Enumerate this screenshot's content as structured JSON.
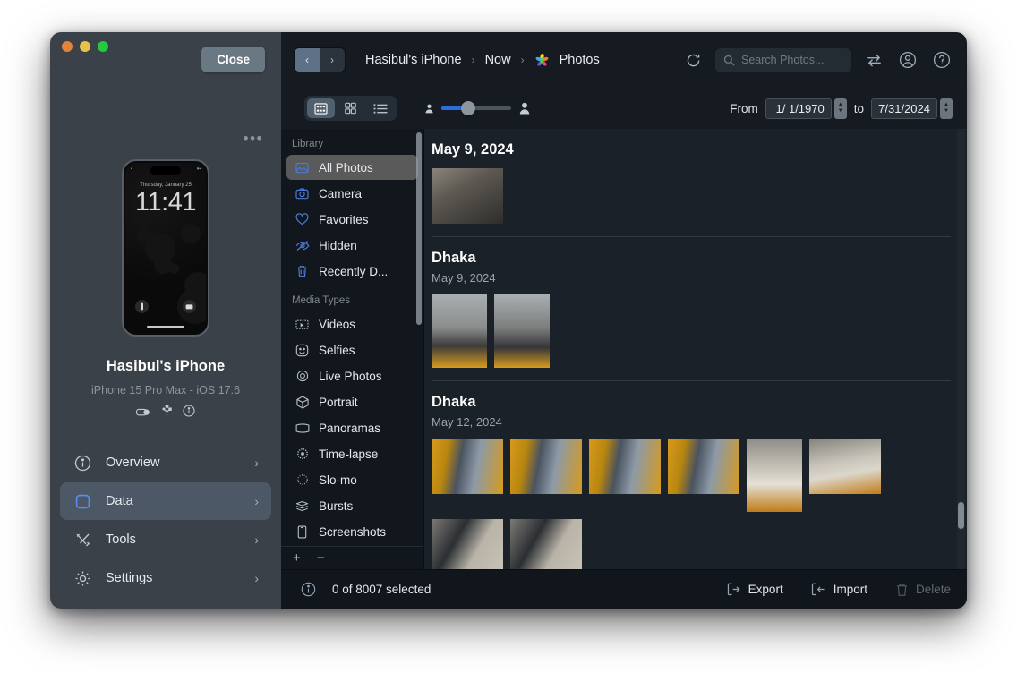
{
  "window": {
    "close_label": "Close",
    "overflow_label": "•••"
  },
  "device": {
    "name": "Hasibul's iPhone",
    "model": "iPhone 15 Pro Max - iOS 17.6",
    "lock_time": "11:41",
    "lock_date": "Thursday, January 25",
    "status_icons": [
      "battery-icon",
      "usb-icon",
      "info-icon"
    ],
    "nav": [
      {
        "label": "Overview",
        "icon": "info-circle-icon",
        "active": false
      },
      {
        "label": "Data",
        "icon": "square-icon",
        "active": true
      },
      {
        "label": "Tools",
        "icon": "tools-icon",
        "active": false
      },
      {
        "label": "Settings",
        "icon": "gear-icon",
        "active": false
      }
    ]
  },
  "topbar": {
    "back_label": "‹",
    "forward_label": "›",
    "breadcrumbs": [
      "Hasibul's iPhone",
      "Now",
      "Photos"
    ],
    "separator": "›",
    "app_icon": "photos-flower-icon",
    "search_placeholder": "Search Photos...",
    "search_value": "",
    "icons": [
      "refresh-icon",
      "search-icon",
      "transfer-icon",
      "account-icon",
      "help-icon"
    ]
  },
  "toolbar": {
    "views": [
      {
        "name": "grid-compact-view",
        "active": true
      },
      {
        "name": "grid-large-view",
        "active": false
      },
      {
        "name": "list-view",
        "active": false
      }
    ],
    "zoom_percent": 38,
    "from_label": "From",
    "to_label": "to",
    "from_date": "1/  1/1970",
    "to_date": "7/31/2024"
  },
  "library": {
    "sections": [
      {
        "header": "Library",
        "items": [
          {
            "label": "All Photos",
            "icon": "photos-icon",
            "active": true,
            "tint": "blue"
          },
          {
            "label": "Camera",
            "icon": "camera-icon",
            "active": false,
            "tint": "blue"
          },
          {
            "label": "Favorites",
            "icon": "heart-icon",
            "active": false,
            "tint": "blue"
          },
          {
            "label": "Hidden",
            "icon": "eye-slash-icon",
            "active": false,
            "tint": "blue"
          },
          {
            "label": "Recently D...",
            "icon": "trash-icon",
            "active": false,
            "tint": "blue"
          }
        ]
      },
      {
        "header": "Media Types",
        "items": [
          {
            "label": "Videos",
            "icon": "video-icon",
            "active": false,
            "tint": "gray"
          },
          {
            "label": "Selfies",
            "icon": "selfie-icon",
            "active": false,
            "tint": "gray"
          },
          {
            "label": "Live Photos",
            "icon": "live-photo-icon",
            "active": false,
            "tint": "gray"
          },
          {
            "label": "Portrait",
            "icon": "portrait-icon",
            "active": false,
            "tint": "gray"
          },
          {
            "label": "Panoramas",
            "icon": "panorama-icon",
            "active": false,
            "tint": "gray"
          },
          {
            "label": "Time-lapse",
            "icon": "timelapse-icon",
            "active": false,
            "tint": "gray"
          },
          {
            "label": "Slo-mo",
            "icon": "slomo-icon",
            "active": false,
            "tint": "gray"
          },
          {
            "label": "Bursts",
            "icon": "bursts-icon",
            "active": false,
            "tint": "gray"
          },
          {
            "label": "Screenshots",
            "icon": "screenshot-icon",
            "active": false,
            "tint": "gray"
          }
        ]
      }
    ],
    "add_label": "+",
    "remove_label": "−"
  },
  "photo_groups": [
    {
      "title": "May 9, 2024",
      "has_subtitle": false,
      "subtitle": "",
      "thumbs": [
        {
          "name": "photo-thumb",
          "orientation": "landscape",
          "c1": "#6f6a63",
          "c2": "#2b2a28"
        }
      ]
    },
    {
      "title": "Dhaka",
      "has_subtitle": true,
      "subtitle": "May 9, 2024",
      "thumbs": [
        {
          "name": "photo-thumb",
          "orientation": "portrait",
          "c1": "#9aa0a4",
          "c2": "#d39a1e"
        },
        {
          "name": "photo-thumb",
          "orientation": "portrait",
          "c1": "#9aa0a4",
          "c2": "#d39a1e"
        }
      ]
    },
    {
      "title": "Dhaka",
      "has_subtitle": true,
      "subtitle": "May 12, 2024",
      "thumbs": [
        {
          "name": "photo-thumb",
          "orientation": "landscape",
          "c1": "#d99b1c",
          "c2": "#3a4450"
        },
        {
          "name": "photo-thumb",
          "orientation": "landscape",
          "c1": "#d99b1c",
          "c2": "#3a4450"
        },
        {
          "name": "photo-thumb",
          "orientation": "landscape",
          "c1": "#d99b1c",
          "c2": "#3a4450"
        },
        {
          "name": "photo-thumb",
          "orientation": "landscape",
          "c1": "#d99b1c",
          "c2": "#3a4450"
        },
        {
          "name": "photo-thumb",
          "orientation": "portrait",
          "c1": "#c9c4bb",
          "c2": "#b5761a"
        },
        {
          "name": "photo-thumb",
          "orientation": "landscape",
          "c1": "#c9c4bb",
          "c2": "#b5761a"
        },
        {
          "name": "photo-thumb",
          "orientation": "landscape",
          "c1": "#8a8880",
          "c2": "#262a2e"
        },
        {
          "name": "photo-thumb",
          "orientation": "landscape",
          "c1": "#8a8880",
          "c2": "#262a2e"
        }
      ]
    }
  ],
  "statusbar": {
    "selection_text": "0 of 8007 selected",
    "actions": [
      {
        "label": "Export",
        "icon": "export-icon",
        "disabled": false
      },
      {
        "label": "Import",
        "icon": "import-icon",
        "disabled": false
      },
      {
        "label": "Delete",
        "icon": "trash-icon",
        "disabled": true
      }
    ]
  },
  "colors": {
    "accent_blue": "#2a6ddb",
    "icon_blue": "#4b79d8",
    "panel_gray": "#3b4148",
    "main_bg": "#161b21",
    "photos_bg": "#1b2128"
  }
}
